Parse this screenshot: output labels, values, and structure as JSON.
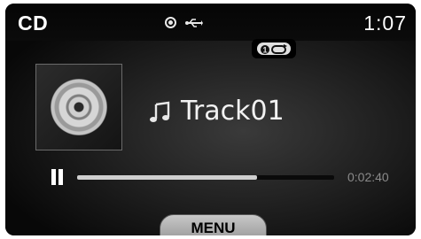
{
  "status_bar": {
    "source": "CD",
    "clock": "1:07",
    "icons": [
      "disc-icon",
      "usb-icon"
    ]
  },
  "mode_indicator": {
    "icon": "repeat-one-icon"
  },
  "album_art": {
    "icon": "cd-disc-icon"
  },
  "track": {
    "icon": "music-note-icon",
    "title": "Track01"
  },
  "playback": {
    "state_icon": "pause-icon",
    "progress": 0.7,
    "time": "0:02:40"
  },
  "menu_button": {
    "label": "MENU"
  }
}
